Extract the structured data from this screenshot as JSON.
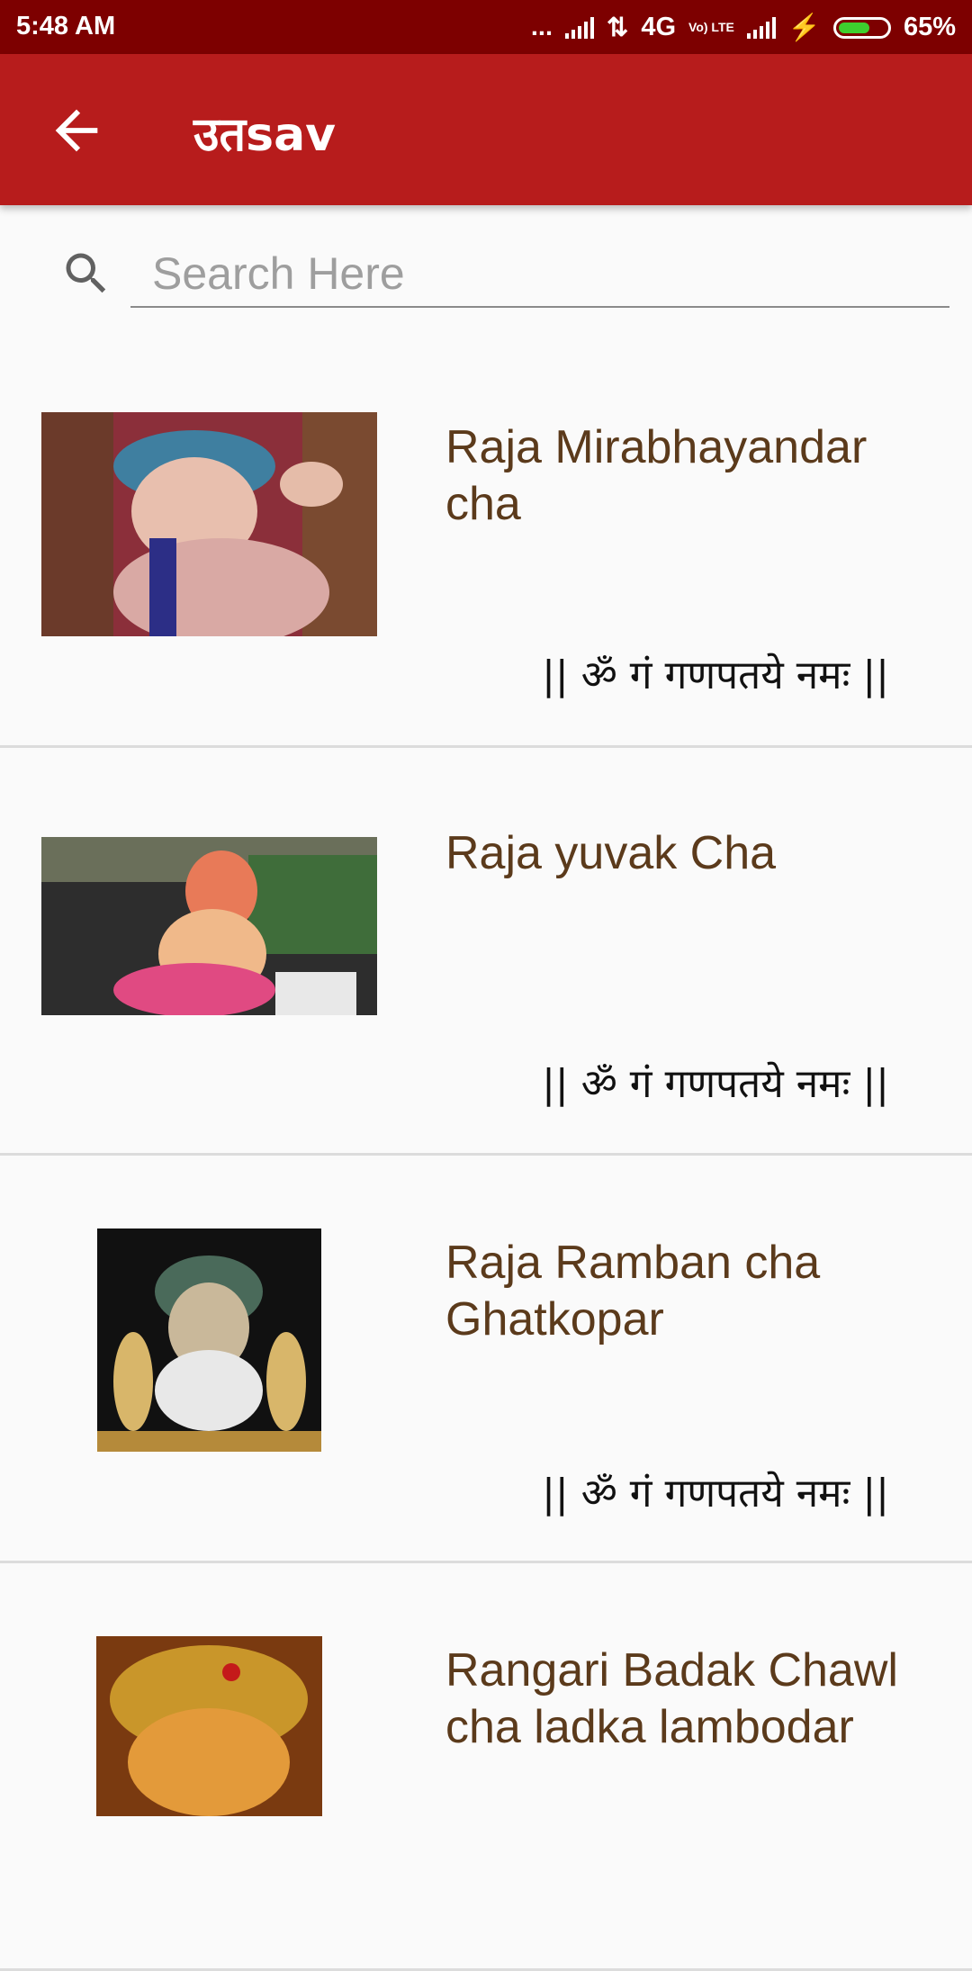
{
  "status_bar": {
    "time": "5:48 AM",
    "dots": "...",
    "network": "4G",
    "volte": "Vo) LTE",
    "battery_percent": "65%",
    "battery_level": 0.65
  },
  "app_bar": {
    "title": "उतsav",
    "back_icon": "arrow-back-icon"
  },
  "search": {
    "placeholder": "Search Here",
    "value": "",
    "icon": "search-icon"
  },
  "items": [
    {
      "title": "Raja Mirabhayandar cha",
      "mantra": "||  ॐ गं गणपतये नमः ||",
      "image": "ganesh-idol-photo"
    },
    {
      "title": "Raja yuvak Cha",
      "mantra": "||  ॐ गं गणपतये नमः ||",
      "image": "ganesh-idol-photo"
    },
    {
      "title": "Raja Ramban cha Ghatkopar",
      "mantra": "||  ॐ गं गणपतये नमः ||",
      "image": "ganesh-idol-photo"
    },
    {
      "title": "Rangari Badak Chawl cha ladka lambodar",
      "mantra": "",
      "image": "ganesh-idol-photo"
    }
  ],
  "colors": {
    "status_bar": "#7d0000",
    "app_bar": "#b71c1c",
    "title_text": "#5b3a1b",
    "background": "#fafafa"
  }
}
